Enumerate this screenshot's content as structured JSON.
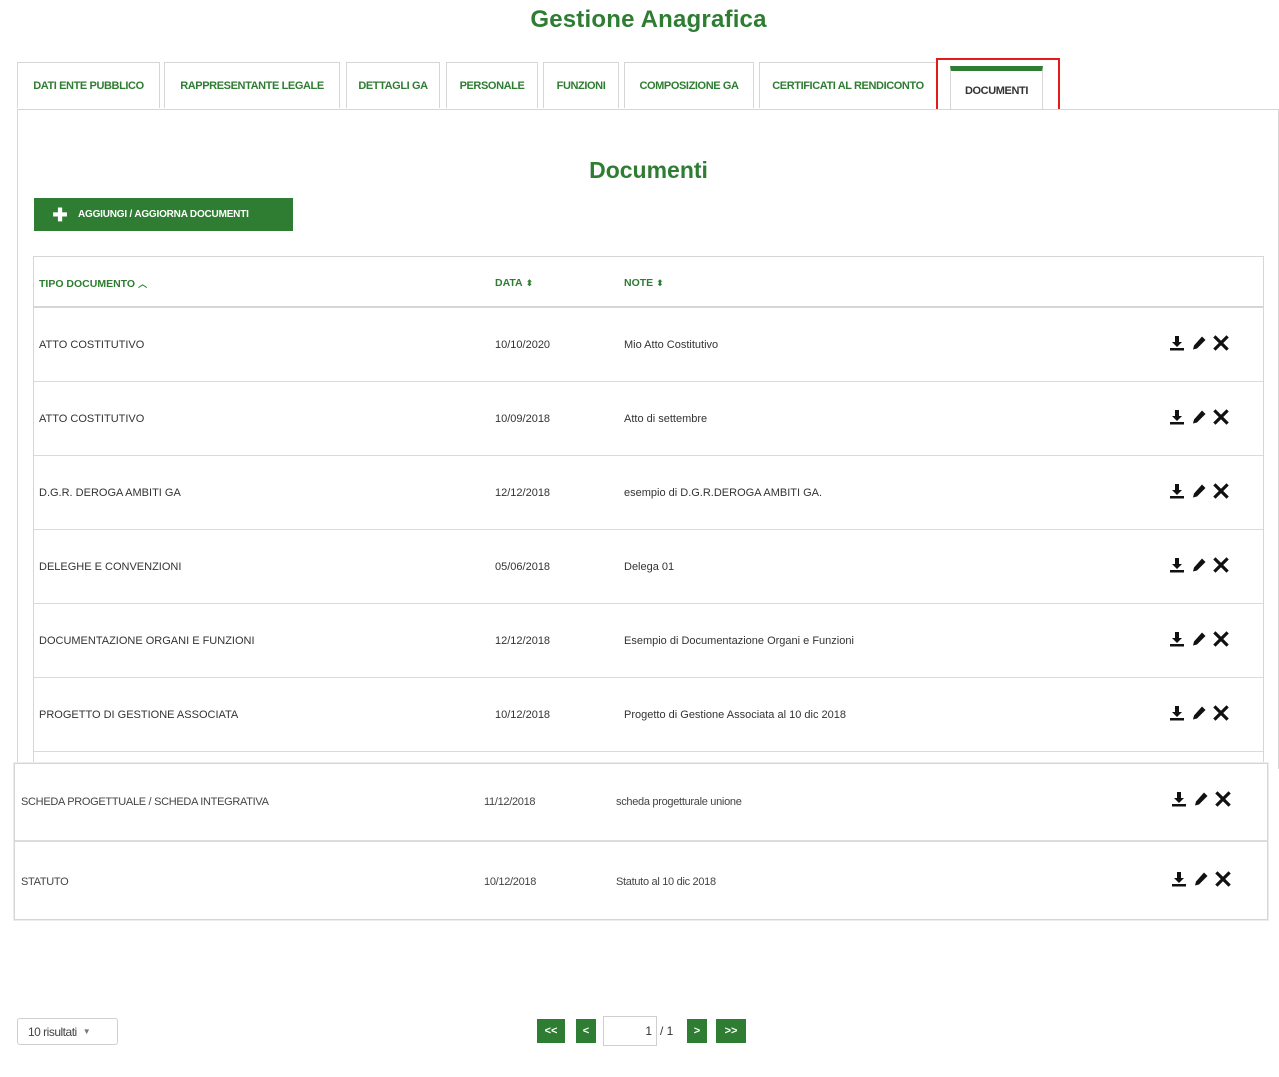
{
  "page": {
    "title": "Gestione Anagrafica"
  },
  "tabs": [
    {
      "label": "DATI ENTE PUBBLICO"
    },
    {
      "label": "RAPPRESENTANTE LEGALE"
    },
    {
      "label": "DETTAGLI GA"
    },
    {
      "label": "PERSONALE"
    },
    {
      "label": "FUNZIONI"
    },
    {
      "label": "COMPOSIZIONE GA"
    },
    {
      "label": "CERTIFICATI AL RENDICONTO"
    },
    {
      "label": "DOCUMENTI",
      "active": true
    }
  ],
  "section": {
    "title": "Documenti"
  },
  "add_button": {
    "label": "AGGIUNGI / AGGIORNA DOCUMENTI",
    "icon": "plus-icon"
  },
  "table": {
    "columns": [
      {
        "label": "TIPO DOCUMENTO",
        "sort": "asc"
      },
      {
        "label": "DATA",
        "sort": "both"
      },
      {
        "label": "NOTE",
        "sort": "both"
      }
    ],
    "rows": [
      {
        "tipo": "ATTO COSTITUTIVO",
        "data": "10/10/2020",
        "note": "Mio Atto Costitutivo"
      },
      {
        "tipo": "ATTO COSTITUTIVO",
        "data": "10/09/2018",
        "note": "Atto di settembre"
      },
      {
        "tipo": "D.G.R. DEROGA AMBITI GA",
        "data": "12/12/2018",
        "note": "esempio di D.G.R.DEROGA AMBITI GA."
      },
      {
        "tipo": "DELEGHE E CONVENZIONI",
        "data": "05/06/2018",
        "note": "Delega 01"
      },
      {
        "tipo": "DOCUMENTAZIONE ORGANI E FUNZIONI",
        "data": "12/12/2018",
        "note": "Esempio di Documentazione Organi e Funzioni"
      },
      {
        "tipo": "PROGETTO DI GESTIONE ASSOCIATA",
        "data": "10/12/2018",
        "note": "Progetto di Gestione Associata al 10 dic 2018"
      },
      {
        "tipo": "SCHEDA PROGETTUALE / SCHEDA INTEGRATIVA",
        "data": "11/12/2018",
        "note": "scheda progetturale unione"
      },
      {
        "tipo": "STATUTO",
        "data": "10/12/2018",
        "note": "Statuto al 10 dic 2018"
      }
    ],
    "row_actions": [
      "download-icon",
      "edit-icon",
      "delete-icon"
    ]
  },
  "footer": {
    "page_size": "10 risultati",
    "pager": {
      "first": "<<",
      "prev": "<",
      "current": "1",
      "total": "/ 1",
      "next": ">",
      "last": ">>"
    }
  },
  "colors": {
    "brand": "#2e7d32",
    "highlight": "#e21b1b"
  }
}
